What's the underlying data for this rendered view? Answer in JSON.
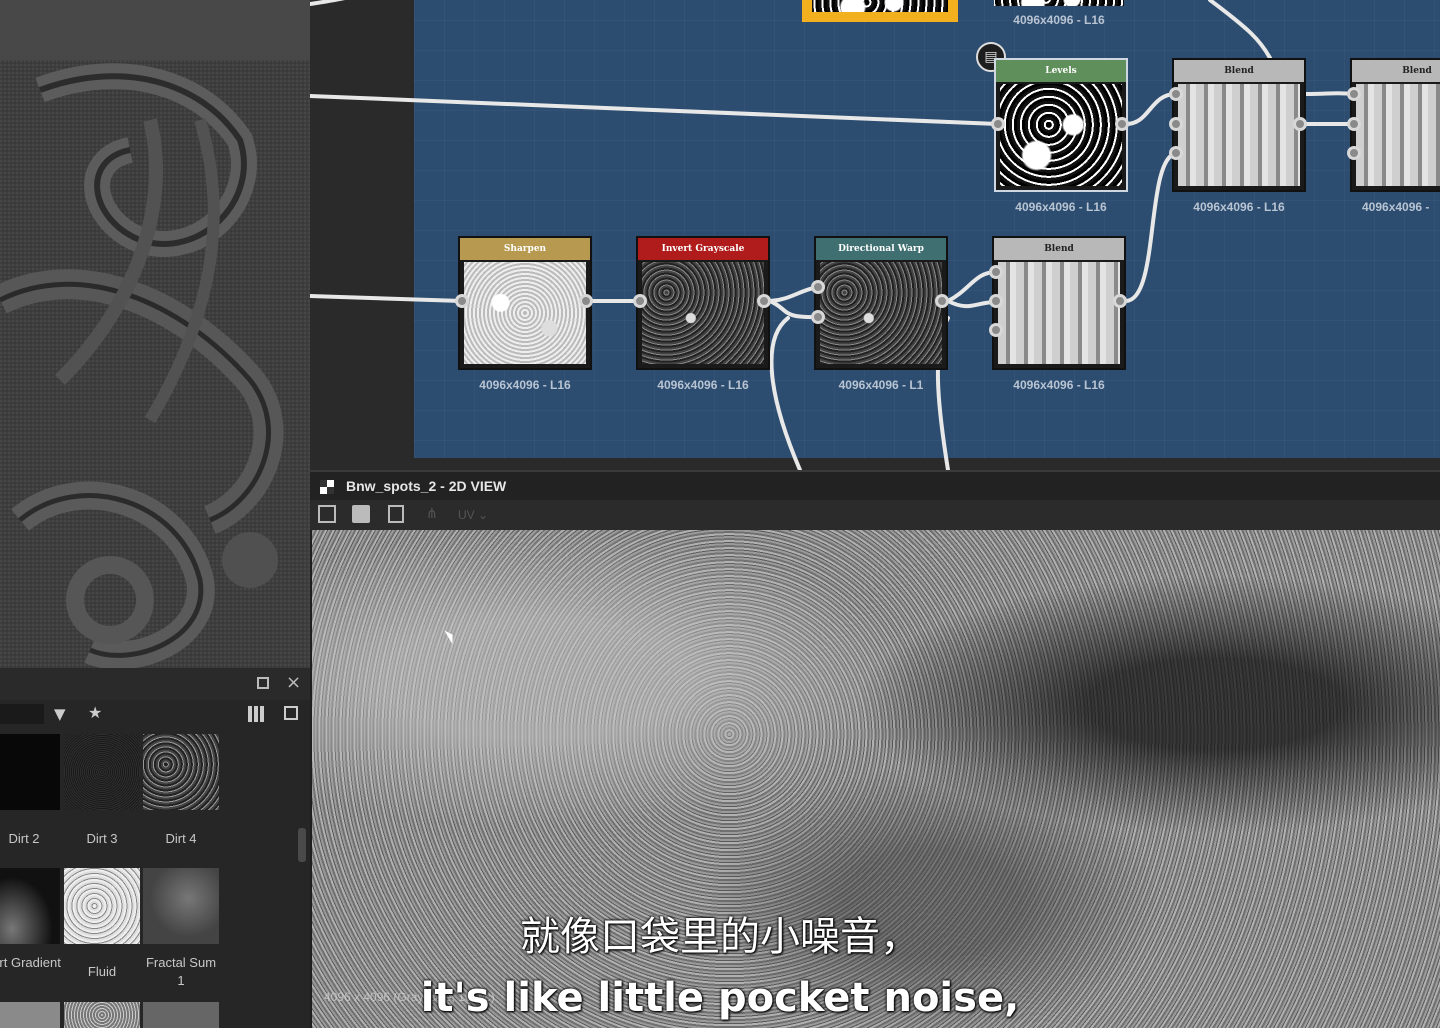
{
  "graph": {
    "resolution": "4096x4096 - L16",
    "resolution_partial": "4096x4096 -",
    "resolution_cut": "4096x4096 - L1",
    "nodes": {
      "levels": "Levels",
      "blend": "Blend",
      "sharpen": "Sharpen",
      "invert": "Invert Grayscale",
      "warp": "Directional Warp"
    },
    "colors": {
      "levels": "#5f8f5a",
      "blend": "#b8b8b8",
      "sharpen": "#b79a4f",
      "invert": "#b01c1c",
      "warp": "#3f6f70",
      "frame": "#2c4c70",
      "selected": "#f2b01e"
    }
  },
  "view2d": {
    "title": "Bnw_spots_2 - 2D VIEW",
    "uv_label": "UV",
    "info": "4096 x 4096 (Grayscale, 16bpc)"
  },
  "library": {
    "row1": [
      "Dirt 2",
      "Dirt 3",
      "Dirt 4"
    ],
    "row2": [
      "Dirt Gradient",
      "Fluid",
      "Fractal Sum 1"
    ]
  },
  "subtitles": {
    "zh": "就像口袋里的小噪音，",
    "en": "it's like little pocket noise,"
  }
}
